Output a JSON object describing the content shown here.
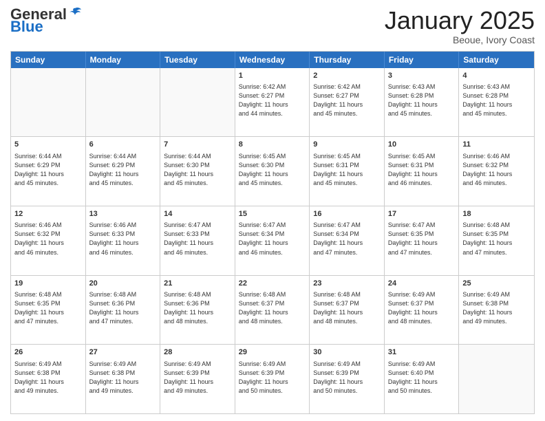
{
  "header": {
    "logo_general": "General",
    "logo_blue": "Blue",
    "month_title": "January 2025",
    "subtitle": "Beoue, Ivory Coast"
  },
  "weekdays": [
    "Sunday",
    "Monday",
    "Tuesday",
    "Wednesday",
    "Thursday",
    "Friday",
    "Saturday"
  ],
  "rows": [
    [
      {
        "day": "",
        "info": ""
      },
      {
        "day": "",
        "info": ""
      },
      {
        "day": "",
        "info": ""
      },
      {
        "day": "1",
        "info": "Sunrise: 6:42 AM\nSunset: 6:27 PM\nDaylight: 11 hours\nand 44 minutes."
      },
      {
        "day": "2",
        "info": "Sunrise: 6:42 AM\nSunset: 6:27 PM\nDaylight: 11 hours\nand 45 minutes."
      },
      {
        "day": "3",
        "info": "Sunrise: 6:43 AM\nSunset: 6:28 PM\nDaylight: 11 hours\nand 45 minutes."
      },
      {
        "day": "4",
        "info": "Sunrise: 6:43 AM\nSunset: 6:28 PM\nDaylight: 11 hours\nand 45 minutes."
      }
    ],
    [
      {
        "day": "5",
        "info": "Sunrise: 6:44 AM\nSunset: 6:29 PM\nDaylight: 11 hours\nand 45 minutes."
      },
      {
        "day": "6",
        "info": "Sunrise: 6:44 AM\nSunset: 6:29 PM\nDaylight: 11 hours\nand 45 minutes."
      },
      {
        "day": "7",
        "info": "Sunrise: 6:44 AM\nSunset: 6:30 PM\nDaylight: 11 hours\nand 45 minutes."
      },
      {
        "day": "8",
        "info": "Sunrise: 6:45 AM\nSunset: 6:30 PM\nDaylight: 11 hours\nand 45 minutes."
      },
      {
        "day": "9",
        "info": "Sunrise: 6:45 AM\nSunset: 6:31 PM\nDaylight: 11 hours\nand 45 minutes."
      },
      {
        "day": "10",
        "info": "Sunrise: 6:45 AM\nSunset: 6:31 PM\nDaylight: 11 hours\nand 46 minutes."
      },
      {
        "day": "11",
        "info": "Sunrise: 6:46 AM\nSunset: 6:32 PM\nDaylight: 11 hours\nand 46 minutes."
      }
    ],
    [
      {
        "day": "12",
        "info": "Sunrise: 6:46 AM\nSunset: 6:32 PM\nDaylight: 11 hours\nand 46 minutes."
      },
      {
        "day": "13",
        "info": "Sunrise: 6:46 AM\nSunset: 6:33 PM\nDaylight: 11 hours\nand 46 minutes."
      },
      {
        "day": "14",
        "info": "Sunrise: 6:47 AM\nSunset: 6:33 PM\nDaylight: 11 hours\nand 46 minutes."
      },
      {
        "day": "15",
        "info": "Sunrise: 6:47 AM\nSunset: 6:34 PM\nDaylight: 11 hours\nand 46 minutes."
      },
      {
        "day": "16",
        "info": "Sunrise: 6:47 AM\nSunset: 6:34 PM\nDaylight: 11 hours\nand 47 minutes."
      },
      {
        "day": "17",
        "info": "Sunrise: 6:47 AM\nSunset: 6:35 PM\nDaylight: 11 hours\nand 47 minutes."
      },
      {
        "day": "18",
        "info": "Sunrise: 6:48 AM\nSunset: 6:35 PM\nDaylight: 11 hours\nand 47 minutes."
      }
    ],
    [
      {
        "day": "19",
        "info": "Sunrise: 6:48 AM\nSunset: 6:35 PM\nDaylight: 11 hours\nand 47 minutes."
      },
      {
        "day": "20",
        "info": "Sunrise: 6:48 AM\nSunset: 6:36 PM\nDaylight: 11 hours\nand 47 minutes."
      },
      {
        "day": "21",
        "info": "Sunrise: 6:48 AM\nSunset: 6:36 PM\nDaylight: 11 hours\nand 48 minutes."
      },
      {
        "day": "22",
        "info": "Sunrise: 6:48 AM\nSunset: 6:37 PM\nDaylight: 11 hours\nand 48 minutes."
      },
      {
        "day": "23",
        "info": "Sunrise: 6:48 AM\nSunset: 6:37 PM\nDaylight: 11 hours\nand 48 minutes."
      },
      {
        "day": "24",
        "info": "Sunrise: 6:49 AM\nSunset: 6:37 PM\nDaylight: 11 hours\nand 48 minutes."
      },
      {
        "day": "25",
        "info": "Sunrise: 6:49 AM\nSunset: 6:38 PM\nDaylight: 11 hours\nand 49 minutes."
      }
    ],
    [
      {
        "day": "26",
        "info": "Sunrise: 6:49 AM\nSunset: 6:38 PM\nDaylight: 11 hours\nand 49 minutes."
      },
      {
        "day": "27",
        "info": "Sunrise: 6:49 AM\nSunset: 6:38 PM\nDaylight: 11 hours\nand 49 minutes."
      },
      {
        "day": "28",
        "info": "Sunrise: 6:49 AM\nSunset: 6:39 PM\nDaylight: 11 hours\nand 49 minutes."
      },
      {
        "day": "29",
        "info": "Sunrise: 6:49 AM\nSunset: 6:39 PM\nDaylight: 11 hours\nand 50 minutes."
      },
      {
        "day": "30",
        "info": "Sunrise: 6:49 AM\nSunset: 6:39 PM\nDaylight: 11 hours\nand 50 minutes."
      },
      {
        "day": "31",
        "info": "Sunrise: 6:49 AM\nSunset: 6:40 PM\nDaylight: 11 hours\nand 50 minutes."
      },
      {
        "day": "",
        "info": ""
      }
    ]
  ]
}
